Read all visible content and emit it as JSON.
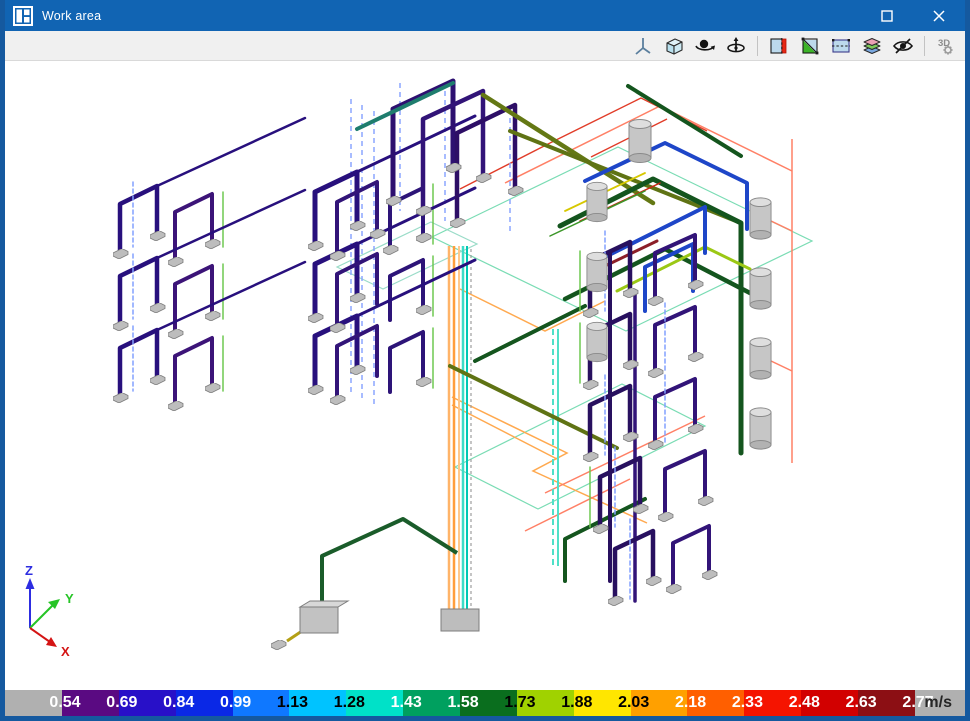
{
  "window": {
    "title": "Work area",
    "titlebar_color": "#1164b3",
    "border_color": "#15599f"
  },
  "titlebar": {
    "controls": [
      "maximize-button",
      "close-button"
    ]
  },
  "toolbar": {
    "buttons": [
      "view-axis-tripod",
      "view-cube",
      "orbit-view",
      "turntable-rotate",
      "section-vertical",
      "clip-plane-diagonal",
      "section-horizontal",
      "layers",
      "hide-elements",
      "3d-settings"
    ]
  },
  "viewport": {
    "axis": {
      "x_label": "X",
      "y_label": "Y",
      "z_label": "Z",
      "x_color": "#d41414",
      "y_color": "#26c426",
      "z_color": "#2d2de1"
    }
  },
  "model": {
    "equipment_color": "#c2c2c2",
    "pipe_colors": [
      "#28107d",
      "#321478",
      "#1e46c8",
      "#82a0ff",
      "#14551e",
      "#647814",
      "#1e7d6e",
      "#3cdcc8",
      "#ffa94f",
      "#ff8066",
      "#e13c28",
      "#9bc814",
      "#d7c800",
      "#6ec850"
    ]
  },
  "legend": {
    "unit": "m/s",
    "under_range_color": "#b0b0b0",
    "over_range_color": "#b0b0b0",
    "max_value": "2.77",
    "max_label_color": "#ffffff",
    "bands": [
      {
        "min": "0.54",
        "color": "#5a0a82",
        "label_color": "#ffffff"
      },
      {
        "min": "0.69",
        "color": "#2810c8",
        "label_color": "#ffffff"
      },
      {
        "min": "0.84",
        "color": "#0a28e6",
        "label_color": "#ffffff"
      },
      {
        "min": "0.99",
        "color": "#0f78ff",
        "label_color": "#ffffff"
      },
      {
        "min": "1.13",
        "color": "#00c3ff",
        "label_color": "#000000"
      },
      {
        "min": "1.28",
        "color": "#00e1c8",
        "label_color": "#000000"
      },
      {
        "min": "1.43",
        "color": "#00a05f",
        "label_color": "#ffffff"
      },
      {
        "min": "1.58",
        "color": "#0a6e1e",
        "label_color": "#ffffff"
      },
      {
        "min": "1.73",
        "color": "#a0d200",
        "label_color": "#000000"
      },
      {
        "min": "1.88",
        "color": "#ffe600",
        "label_color": "#000000"
      },
      {
        "min": "2.03",
        "color": "#ffa000",
        "label_color": "#000000"
      },
      {
        "min": "2.18",
        "color": "#ff5f00",
        "label_color": "#ffffff"
      },
      {
        "min": "2.33",
        "color": "#f51400",
        "label_color": "#ffffff"
      },
      {
        "min": "2.48",
        "color": "#d20000",
        "label_color": "#ffffff"
      },
      {
        "min": "2.63",
        "color": "#8c0f14",
        "label_color": "#ffffff"
      }
    ]
  }
}
